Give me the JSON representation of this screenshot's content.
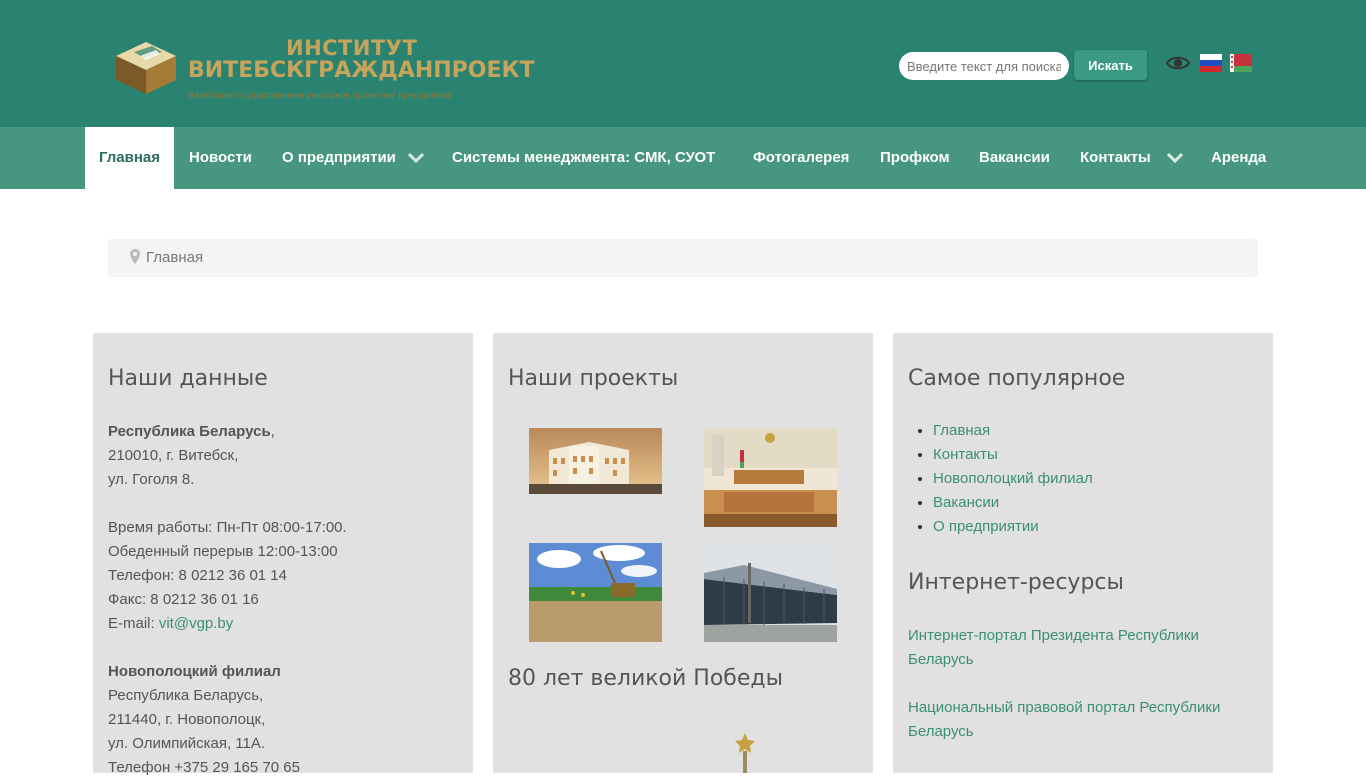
{
  "header": {
    "logo_line1": "ИНСТИТУТ",
    "logo_line2": "ВИТЕБСКГРАЖДАНПРОЕКТ",
    "logo_sub": "Витебское государственное унитарное проектное предприятие",
    "search": {
      "placeholder": "Введите текст для поиска...",
      "button_label": "Искать"
    },
    "icons": [
      "eye-icon",
      "flag-ru-icon",
      "flag-by-icon"
    ]
  },
  "nav": {
    "items": [
      {
        "label": "Главная"
      },
      {
        "label": "Новости"
      },
      {
        "label": "О предприятии"
      },
      {
        "label": "Системы менеджмента: СМК, СУОТ"
      },
      {
        "label": "Фотогалерея"
      },
      {
        "label": "Профком"
      },
      {
        "label": "Вакансии"
      },
      {
        "label": "Контакты"
      },
      {
        "label": "Аренда"
      }
    ]
  },
  "breadcrumb": {
    "label": "Главная"
  },
  "left_panel": {
    "title": "Наши данные",
    "country": "Республика Беларусь",
    "address1": "210010, г. Витебск,",
    "address2": "ул. Гоголя 8.",
    "hours": "Время работы: Пн-Пт 08:00-17:00.",
    "lunch": "Обеденный перерыв 12:00-13:00",
    "phone": "Телефон: 8 0212 36 01 14",
    "fax": "Факс: 8 0212 36 01 16",
    "email_label": "E-mail:",
    "email": "vit@vgp.by",
    "branch_title": "Новополоцкий филиал",
    "branch_country": "Республика Беларусь,",
    "branch_address1": "211440, г. Новополоцк,",
    "branch_address2": "ул. Олимпийская, 11А.",
    "branch_phone": "Телефон +375 29 165 70 65"
  },
  "middle_panel": {
    "title": "Наши проекты",
    "subtitle": "80 лет великой Победы"
  },
  "right_panel": {
    "title": "Самое популярное",
    "popular": [
      "Главная",
      "Контакты",
      "Новополоцкий филиал",
      "Вакансии",
      "О предприятии"
    ],
    "resources_title": "Интернет-ресурсы",
    "resource1_line1": "Интернет-портал Президента Республики",
    "resource1_line2": "Беларусь",
    "resource2_line1": "Национальный правовой портал Республики",
    "resource2_line2": "Беларусь"
  },
  "colors": {
    "header_bg": "#2a8270",
    "nav_bg": "#47967f",
    "link": "#3a8f77",
    "logo_gold": "#c7a45b"
  }
}
